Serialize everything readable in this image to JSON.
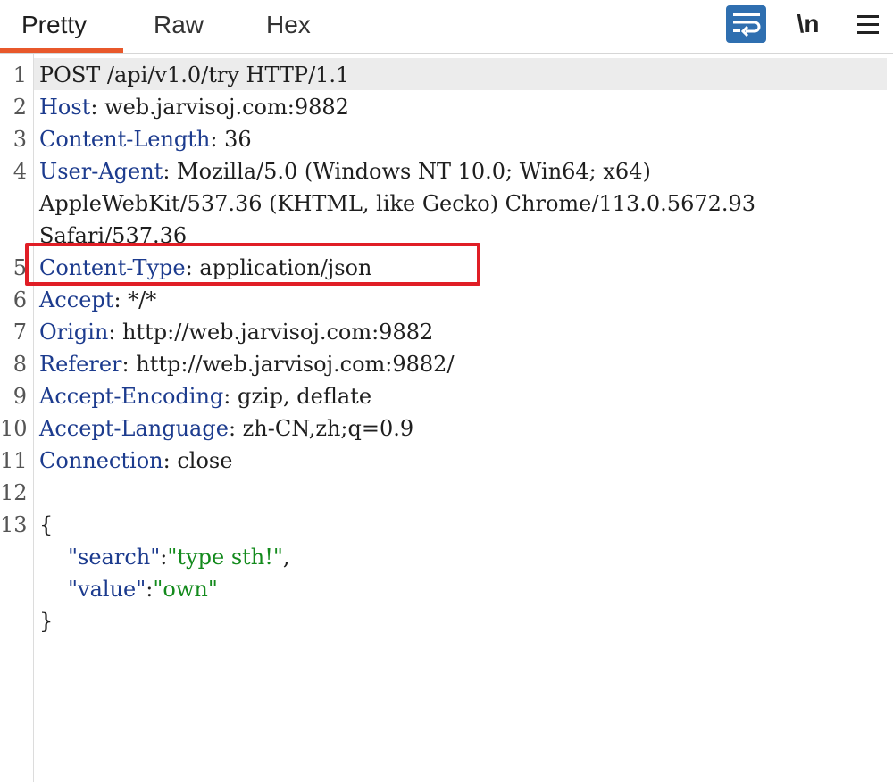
{
  "tabs": [
    {
      "label": "Pretty",
      "active": true
    },
    {
      "label": "Raw",
      "active": false
    },
    {
      "label": "Hex",
      "active": false
    }
  ],
  "toolbar": {
    "wrap_icon": "wrap-lines-icon",
    "newline_label": "\\n",
    "menu_icon": "hamburger-menu-icon",
    "accent_color": "#e8582b",
    "wrap_button_color": "#2f6fb0"
  },
  "editor": {
    "line_numbers": [
      "1",
      "2",
      "3",
      "4",
      "5",
      "6",
      "7",
      "8",
      "9",
      "10",
      "11",
      "12",
      "13"
    ],
    "request_line": "POST /api/v1.0/try HTTP/1.1",
    "headers": [
      {
        "name": "Host",
        "value": "web.jarvisoj.com:9882"
      },
      {
        "name": "Content-Length",
        "value": "36"
      },
      {
        "name": "User-Agent",
        "value": "Mozilla/5.0 (Windows NT 10.0; Win64; x64)"
      },
      {
        "name": "Content-Type",
        "value": "application/json"
      },
      {
        "name": "Accept",
        "value": "*/*"
      },
      {
        "name": "Origin",
        "value": "http://web.jarvisoj.com:9882"
      },
      {
        "name": "Referer",
        "value": "http://web.jarvisoj.com:9882/"
      },
      {
        "name": "Accept-Encoding",
        "value": "gzip, deflate"
      },
      {
        "name": "Accept-Language",
        "value": "zh-CN,zh;q=0.9"
      },
      {
        "name": "Connection",
        "value": "close"
      }
    ],
    "user_agent_cont1": "AppleWebKit/537.36 (KHTML, like Gecko) Chrome/113.0.5672.93",
    "user_agent_cont2": "Safari/537.36",
    "sep": ": ",
    "body": {
      "open_brace": "{",
      "close_brace": "}",
      "fields": [
        {
          "key": "\"search\"",
          "colon": ":",
          "value": "\"type sth!\"",
          "comma": ","
        },
        {
          "key": "\"value\"",
          "colon": ":",
          "value": "\"own\"",
          "comma": ""
        }
      ]
    },
    "highlight_color": "#e01e26"
  }
}
